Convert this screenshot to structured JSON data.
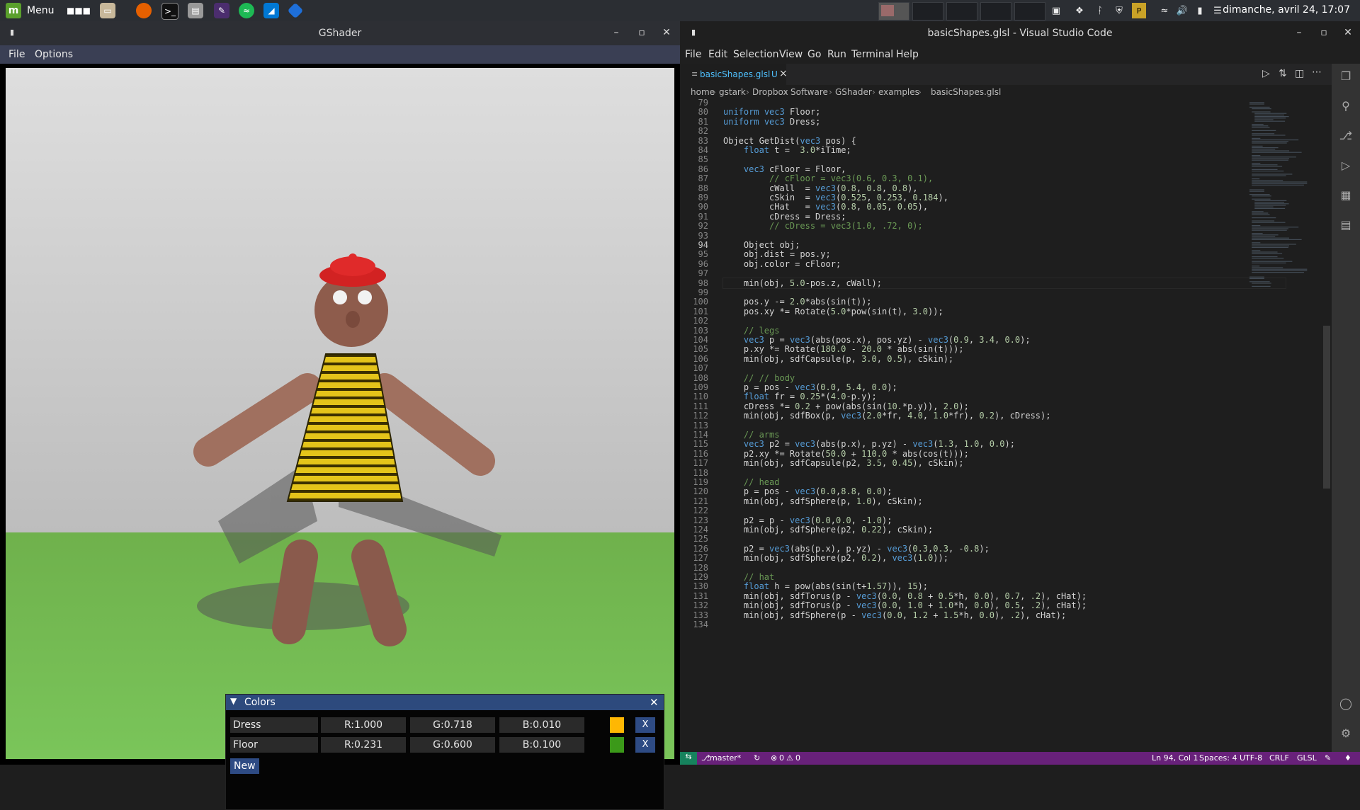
{
  "taskbar": {
    "menu_label": "Menu",
    "clock": "dimanche, avril 24, 17:07",
    "launchers": [
      "apps-icon",
      "files-icon",
      "firefox-icon",
      "terminal-icon",
      "disks-icon",
      "editor-icon",
      "spotify-icon",
      "vscode-icon",
      "app-icon"
    ]
  },
  "gshader": {
    "title": "GShader",
    "menu": [
      "File",
      "Options"
    ],
    "colors_panel": {
      "title": "Colors",
      "rows": [
        {
          "name": "Dress",
          "r": "R:1.000",
          "g": "G:0.718",
          "b": "B:0.010",
          "swatch": "#ffb703",
          "remove": "X"
        },
        {
          "name": "Floor",
          "r": "R:0.231",
          "g": "G:0.600",
          "b": "B:0.100",
          "swatch": "#3b9919",
          "remove": "X"
        }
      ],
      "new_label": "New"
    }
  },
  "vscode": {
    "title": "basicShapes.glsl - Visual Studio Code",
    "menu": [
      "File",
      "Edit",
      "Selection",
      "View",
      "Go",
      "Run",
      "Terminal",
      "Help"
    ],
    "tab": {
      "label": "basicShapes.glsl",
      "status": "U",
      "close": "×"
    },
    "breadcrumb": [
      "home",
      "gstark",
      "Dropbox",
      "Software",
      "GShader",
      "examples",
      "basicShapes.glsl"
    ],
    "current_line": 94,
    "lines": [
      {
        "n": 79,
        "t": ""
      },
      {
        "n": 80,
        "t": "uniform vec3 Floor;"
      },
      {
        "n": 81,
        "t": "uniform vec3 Dress;"
      },
      {
        "n": 82,
        "t": ""
      },
      {
        "n": 83,
        "t": "Object GetDist(vec3 pos) {"
      },
      {
        "n": 84,
        "t": "    float t =  3.0*iTime;"
      },
      {
        "n": 85,
        "t": ""
      },
      {
        "n": 86,
        "t": "    vec3 cFloor = Floor,"
      },
      {
        "n": 87,
        "t": "         // cFloor = vec3(0.6, 0.3, 0.1),"
      },
      {
        "n": 88,
        "t": "         cWall  = vec3(0.8, 0.8, 0.8),"
      },
      {
        "n": 89,
        "t": "         cSkin  = vec3(0.525, 0.253, 0.184),"
      },
      {
        "n": 90,
        "t": "         cHat   = vec3(0.8, 0.05, 0.05),"
      },
      {
        "n": 91,
        "t": "         cDress = Dress;"
      },
      {
        "n": 92,
        "t": "         // cDress = vec3(1.0, .72, 0);"
      },
      {
        "n": 93,
        "t": ""
      },
      {
        "n": 94,
        "t": "    Object obj;"
      },
      {
        "n": 95,
        "t": "    obj.dist = pos.y;"
      },
      {
        "n": 96,
        "t": "    obj.color = cFloor;"
      },
      {
        "n": 97,
        "t": ""
      },
      {
        "n": 98,
        "t": "    min(obj, 5.0-pos.z, cWall);"
      },
      {
        "n": 99,
        "t": ""
      },
      {
        "n": 100,
        "t": "    pos.y -= 2.0*abs(sin(t));"
      },
      {
        "n": 101,
        "t": "    pos.xy *= Rotate(5.0*pow(sin(t), 3.0));"
      },
      {
        "n": 102,
        "t": ""
      },
      {
        "n": 103,
        "t": "    // legs"
      },
      {
        "n": 104,
        "t": "    vec3 p = vec3(abs(pos.x), pos.yz) - vec3(0.9, 3.4, 0.0);"
      },
      {
        "n": 105,
        "t": "    p.xy *= Rotate(180.0 - 20.0 * abs(sin(t)));"
      },
      {
        "n": 106,
        "t": "    min(obj, sdfCapsule(p, 3.0, 0.5), cSkin);"
      },
      {
        "n": 107,
        "t": ""
      },
      {
        "n": 108,
        "t": "    // // body"
      },
      {
        "n": 109,
        "t": "    p = pos - vec3(0.0, 5.4, 0.0);"
      },
      {
        "n": 110,
        "t": "    float fr = 0.25*(4.0-p.y);"
      },
      {
        "n": 111,
        "t": "    cDress *= 0.2 + pow(abs(sin(10.*p.y)), 2.0);"
      },
      {
        "n": 112,
        "t": "    min(obj, sdfBox(p, vec3(2.0*fr, 4.0, 1.0*fr), 0.2), cDress);"
      },
      {
        "n": 113,
        "t": ""
      },
      {
        "n": 114,
        "t": "    // arms"
      },
      {
        "n": 115,
        "t": "    vec3 p2 = vec3(abs(p.x), p.yz) - vec3(1.3, 1.0, 0.0);"
      },
      {
        "n": 116,
        "t": "    p2.xy *= Rotate(50.0 + 110.0 * abs(cos(t)));"
      },
      {
        "n": 117,
        "t": "    min(obj, sdfCapsule(p2, 3.5, 0.45), cSkin);"
      },
      {
        "n": 118,
        "t": ""
      },
      {
        "n": 119,
        "t": "    // head"
      },
      {
        "n": 120,
        "t": "    p = pos - vec3(0.0,8.8, 0.0);"
      },
      {
        "n": 121,
        "t": "    min(obj, sdfSphere(p, 1.0), cSkin);"
      },
      {
        "n": 122,
        "t": ""
      },
      {
        "n": 123,
        "t": "    p2 = p - vec3(0.0,0.0, -1.0);"
      },
      {
        "n": 124,
        "t": "    min(obj, sdfSphere(p2, 0.22), cSkin);"
      },
      {
        "n": 125,
        "t": ""
      },
      {
        "n": 126,
        "t": "    p2 = vec3(abs(p.x), p.yz) - vec3(0.3,0.3, -0.8);"
      },
      {
        "n": 127,
        "t": "    min(obj, sdfSphere(p2, 0.2), vec3(1.0));"
      },
      {
        "n": 128,
        "t": ""
      },
      {
        "n": 129,
        "t": "    // hat"
      },
      {
        "n": 130,
        "t": "    float h = pow(abs(sin(t+1.57)), 15);"
      },
      {
        "n": 131,
        "t": "    min(obj, sdfTorus(p - vec3(0.0, 0.8 + 0.5*h, 0.0), 0.7, .2), cHat);"
      },
      {
        "n": 132,
        "t": "    min(obj, sdfTorus(p - vec3(0.0, 1.0 + 1.0*h, 0.0), 0.5, .2), cHat);"
      },
      {
        "n": 133,
        "t": "    min(obj, sdfSphere(p - vec3(0.0, 1.2 + 1.5*h, 0.0), .2), cHat);"
      },
      {
        "n": 134,
        "t": ""
      }
    ],
    "status": {
      "branch": "master*",
      "problems": "0",
      "warnings": "0",
      "position": "Ln 94, Col 1",
      "spaces": "Spaces: 4",
      "encoding": "UTF-8",
      "eol": "CRLF",
      "language": "GLSL"
    }
  }
}
